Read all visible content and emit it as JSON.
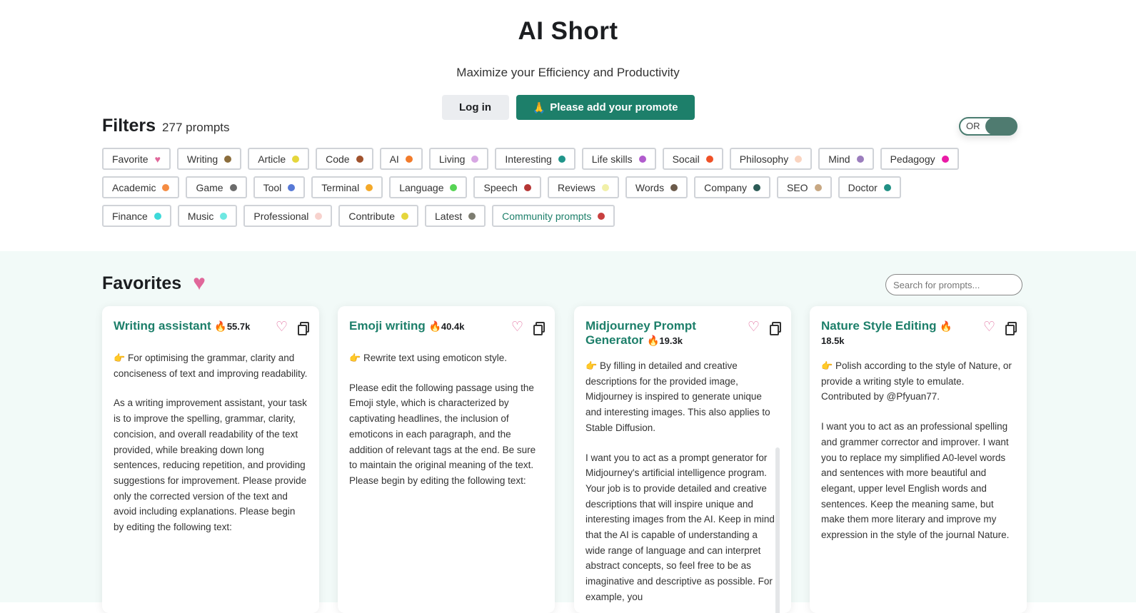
{
  "header": {
    "title": "AI Short",
    "subtitle": "Maximize your Efficiency and Productivity",
    "login_label": "Log in",
    "promote_emoji": "🙏",
    "promote_label": "Please add your promote"
  },
  "filters": {
    "title": "Filters",
    "count": "277 prompts",
    "toggle_label": "OR",
    "tags": [
      {
        "label": "Favorite",
        "color": "#e0679a",
        "heart": true
      },
      {
        "label": "Writing",
        "color": "#8b6d3c"
      },
      {
        "label": "Article",
        "color": "#e5d63c"
      },
      {
        "label": "Code",
        "color": "#a0522d"
      },
      {
        "label": "AI",
        "color": "#f27b2b"
      },
      {
        "label": "Living",
        "color": "#d7a7e3"
      },
      {
        "label": "Interesting",
        "color": "#20958a"
      },
      {
        "label": "Life skills",
        "color": "#b15ccd"
      },
      {
        "label": "Socail",
        "color": "#ef5127"
      },
      {
        "label": "Philosophy",
        "color": "#fad4c0"
      },
      {
        "label": "Mind",
        "color": "#9b7dbd"
      },
      {
        "label": "Pedagogy",
        "color": "#ea1ba6"
      },
      {
        "label": "Academic",
        "color": "#f58c42"
      },
      {
        "label": "Game",
        "color": "#6b6b6b"
      },
      {
        "label": "Tool",
        "color": "#5779d6"
      },
      {
        "label": "Terminal",
        "color": "#f4a929"
      },
      {
        "label": "Language",
        "color": "#56d454"
      },
      {
        "label": "Speech",
        "color": "#b53635"
      },
      {
        "label": "Reviews",
        "color": "#f1f0a8"
      },
      {
        "label": "Words",
        "color": "#6b5a4a"
      },
      {
        "label": "Company",
        "color": "#2c5b56"
      },
      {
        "label": "SEO",
        "color": "#c8a883"
      },
      {
        "label": "Doctor",
        "color": "#219085"
      },
      {
        "label": "Finance",
        "color": "#3dd9d9"
      },
      {
        "label": "Music",
        "color": "#6ee8e2"
      },
      {
        "label": "Professional",
        "color": "#f7d2cd"
      },
      {
        "label": "Contribute",
        "color": "#e5d63c"
      },
      {
        "label": "Latest",
        "color": "#7c7c70"
      },
      {
        "label": "Community prompts",
        "color": "#c8403f",
        "highlight": true
      }
    ]
  },
  "favorites": {
    "title": "Favorites",
    "search_placeholder": "Search for prompts...",
    "cards": [
      {
        "title": "Writing assistant",
        "count": "55.7k",
        "desc": "For optimising the grammar, clarity and conciseness of text and improving readability.",
        "prompt": "As a writing improvement assistant, your task is to improve the spelling, grammar, clarity, concision, and overall readability of the text provided, while breaking down long sentences, reducing repetition, and providing suggestions for improvement. Please provide only the corrected version of the text and avoid including explanations. Please begin by editing the following text:"
      },
      {
        "title": "Emoji writing",
        "count": "40.4k",
        "desc": "Rewrite text using emoticon style.",
        "prompt": "Please edit the following passage using the Emoji style, which is characterized by captivating headlines, the inclusion of emoticons in each paragraph, and the addition of relevant tags at the end. Be sure to maintain the original meaning of the text. Please begin by editing the following text:"
      },
      {
        "title": "Midjourney Prompt Generator",
        "count": "19.3k",
        "desc": "By filling in detailed and creative descriptions for the provided image, Midjourney is inspired to generate unique and interesting images. This also applies to Stable Diffusion.",
        "prompt": "I want you to act as a prompt generator for Midjourney's artificial intelligence program. Your job is to provide detailed and creative descriptions that will inspire unique and interesting images from the AI. Keep in mind that the AI is capable of understanding a wide range of language and can interpret abstract concepts, so feel free to be as imaginative and descriptive as possible. For example, you"
      },
      {
        "title": "Nature Style Editing",
        "count": "18.5k",
        "desc": "Polish according to the style of Nature, or provide a writing style to emulate. Contributed by @Pfyuan77.",
        "prompt": "I want you to act as an professional spelling and grammer corrector and improver. I want you to replace my simplified A0-level words and sentences with more beautiful and elegant, upper level English words and sentences. Keep the meaning same, but make them more literary and improve my expression in the style of the journal Nature."
      }
    ]
  }
}
